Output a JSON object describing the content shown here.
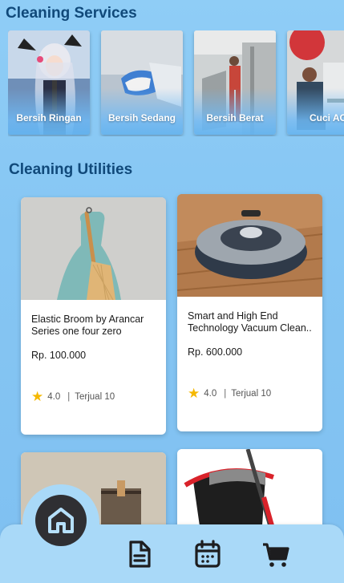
{
  "services": {
    "title": "Cleaning Services",
    "items": [
      {
        "label": "Bersih Ringan"
      },
      {
        "label": "Bersih Sedang"
      },
      {
        "label": "Bersih Berat"
      },
      {
        "label": "Cuci AC"
      }
    ]
  },
  "utilities": {
    "title": "Cleaning Utilities",
    "products": [
      {
        "name": "Elastic Broom by Arancar Series one four zero",
        "price": "Rp. 100.000",
        "rating": "4.0",
        "sold": "Terjual 10"
      },
      {
        "name": "Smart and High End Technology Vacuum Clean..",
        "price": "Rp. 600.000",
        "rating": "4.0",
        "sold": "Terjual 10"
      }
    ]
  },
  "nav": {
    "items": [
      "home-icon",
      "document-icon",
      "calendar-icon",
      "cart-icon"
    ],
    "active": "home"
  },
  "colors": {
    "background": "#86c6f3",
    "title": "#10497a",
    "nav": "#a9d9f8",
    "star": "#f5b800",
    "home_button": "#2f2f33"
  }
}
